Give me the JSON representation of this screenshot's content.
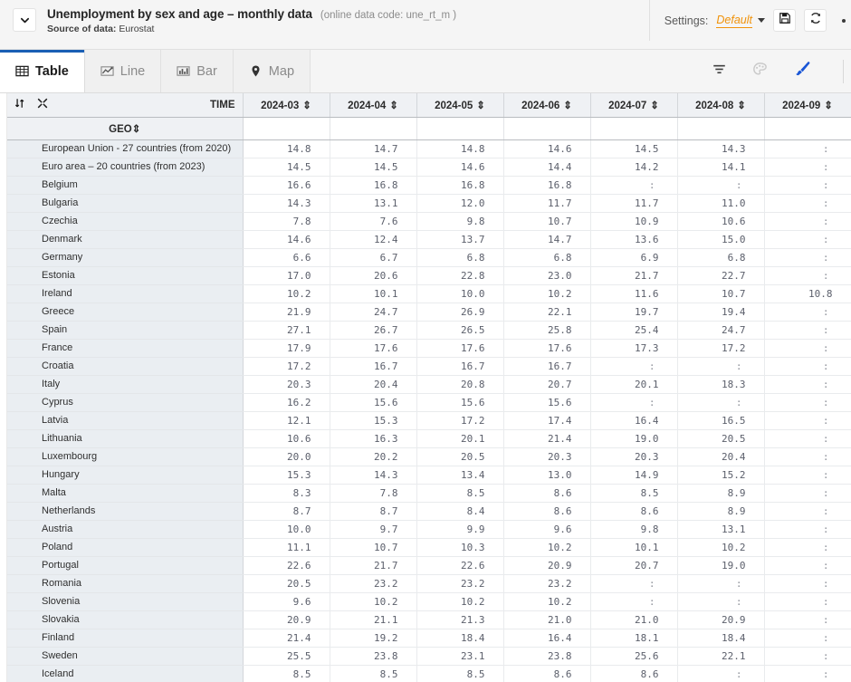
{
  "header": {
    "collapse_icon": "chevron-down-icon",
    "title": "Unemployment by sex and age – monthly data",
    "code": "(online data code: une_rt_m )",
    "source_label": "Source of data:",
    "source_value": "Eurostat",
    "settings_label": "Settings:",
    "settings_value": "Default",
    "save_icon": "floppy-disk-icon",
    "refresh_icon": "refresh-icon",
    "overflow_icon": "kebab-menu-icon",
    "accent_color": "#f0920a"
  },
  "tabs": [
    {
      "label": "Table",
      "icon": "table-grid-icon",
      "active": true
    },
    {
      "label": "Line",
      "icon": "line-chart-icon",
      "active": false
    },
    {
      "label": "Bar",
      "icon": "bar-chart-icon",
      "active": false
    },
    {
      "label": "Map",
      "icon": "map-pin-icon",
      "active": false
    }
  ],
  "toolbar": {
    "filter_icon": "filter-funnel-icon",
    "palette_icon": "color-palette-icon",
    "brush_icon": "paint-brush-icon",
    "active_tool_color": "#1a56d6"
  },
  "table": {
    "time_label": "TIME",
    "geo_label": "GEO",
    "sort_icon": "sort-arrows-icon",
    "collapse_columns_icon": "collapse-arrows-icon",
    "sort_toggle_icon": "sort-updown-icon",
    "no_data_symbol": ":",
    "columns": [
      "2024-03",
      "2024-04",
      "2024-05",
      "2024-06",
      "2024-07",
      "2024-08",
      "2024-09"
    ],
    "rows": [
      {
        "geo": "European Union - 27 countries (from 2020)",
        "values": [
          "14.8",
          "14.7",
          "14.8",
          "14.6",
          "14.5",
          "14.3",
          ":"
        ]
      },
      {
        "geo": "Euro area – 20 countries (from 2023)",
        "values": [
          "14.5",
          "14.5",
          "14.6",
          "14.4",
          "14.2",
          "14.1",
          ":"
        ]
      },
      {
        "geo": "Belgium",
        "values": [
          "16.6",
          "16.8",
          "16.8",
          "16.8",
          ":",
          ":",
          ":"
        ]
      },
      {
        "geo": "Bulgaria",
        "values": [
          "14.3",
          "13.1",
          "12.0",
          "11.7",
          "11.7",
          "11.0",
          ":"
        ]
      },
      {
        "geo": "Czechia",
        "values": [
          "7.8",
          "7.6",
          "9.8",
          "10.7",
          "10.9",
          "10.6",
          ":"
        ]
      },
      {
        "geo": "Denmark",
        "values": [
          "14.6",
          "12.4",
          "13.7",
          "14.7",
          "13.6",
          "15.0",
          ":"
        ]
      },
      {
        "geo": "Germany",
        "values": [
          "6.6",
          "6.7",
          "6.8",
          "6.8",
          "6.9",
          "6.8",
          ":"
        ]
      },
      {
        "geo": "Estonia",
        "values": [
          "17.0",
          "20.6",
          "22.8",
          "23.0",
          "21.7",
          "22.7",
          ":"
        ]
      },
      {
        "geo": "Ireland",
        "values": [
          "10.2",
          "10.1",
          "10.0",
          "10.2",
          "11.6",
          "10.7",
          "10.8"
        ]
      },
      {
        "geo": "Greece",
        "values": [
          "21.9",
          "24.7",
          "26.9",
          "22.1",
          "19.7",
          "19.4",
          ":"
        ]
      },
      {
        "geo": "Spain",
        "values": [
          "27.1",
          "26.7",
          "26.5",
          "25.8",
          "25.4",
          "24.7",
          ":"
        ]
      },
      {
        "geo": "France",
        "values": [
          "17.9",
          "17.6",
          "17.6",
          "17.6",
          "17.3",
          "17.2",
          ":"
        ]
      },
      {
        "geo": "Croatia",
        "values": [
          "17.2",
          "16.7",
          "16.7",
          "16.7",
          ":",
          ":",
          ":"
        ]
      },
      {
        "geo": "Italy",
        "values": [
          "20.3",
          "20.4",
          "20.8",
          "20.7",
          "20.1",
          "18.3",
          ":"
        ]
      },
      {
        "geo": "Cyprus",
        "values": [
          "16.2",
          "15.6",
          "15.6",
          "15.6",
          ":",
          ":",
          ":"
        ]
      },
      {
        "geo": "Latvia",
        "values": [
          "12.1",
          "15.3",
          "17.2",
          "17.4",
          "16.4",
          "16.5",
          ":"
        ]
      },
      {
        "geo": "Lithuania",
        "values": [
          "10.6",
          "16.3",
          "20.1",
          "21.4",
          "19.0",
          "20.5",
          ":"
        ]
      },
      {
        "geo": "Luxembourg",
        "values": [
          "20.0",
          "20.2",
          "20.5",
          "20.3",
          "20.3",
          "20.4",
          ":"
        ]
      },
      {
        "geo": "Hungary",
        "values": [
          "15.3",
          "14.3",
          "13.4",
          "13.0",
          "14.9",
          "15.2",
          ":"
        ]
      },
      {
        "geo": "Malta",
        "values": [
          "8.3",
          "7.8",
          "8.5",
          "8.6",
          "8.5",
          "8.9",
          ":"
        ]
      },
      {
        "geo": "Netherlands",
        "values": [
          "8.7",
          "8.7",
          "8.4",
          "8.6",
          "8.6",
          "8.9",
          ":"
        ]
      },
      {
        "geo": "Austria",
        "values": [
          "10.0",
          "9.7",
          "9.9",
          "9.6",
          "9.8",
          "13.1",
          ":"
        ]
      },
      {
        "geo": "Poland",
        "values": [
          "11.1",
          "10.7",
          "10.3",
          "10.2",
          "10.1",
          "10.2",
          ":"
        ]
      },
      {
        "geo": "Portugal",
        "values": [
          "22.6",
          "21.7",
          "22.6",
          "20.9",
          "20.7",
          "19.0",
          ":"
        ]
      },
      {
        "geo": "Romania",
        "values": [
          "20.5",
          "23.2",
          "23.2",
          "23.2",
          ":",
          ":",
          ":"
        ]
      },
      {
        "geo": "Slovenia",
        "values": [
          "9.6",
          "10.2",
          "10.2",
          "10.2",
          ":",
          ":",
          ":"
        ]
      },
      {
        "geo": "Slovakia",
        "values": [
          "20.9",
          "21.1",
          "21.3",
          "21.0",
          "21.0",
          "20.9",
          ":"
        ]
      },
      {
        "geo": "Finland",
        "values": [
          "21.4",
          "19.2",
          "18.4",
          "16.4",
          "18.1",
          "18.4",
          ":"
        ]
      },
      {
        "geo": "Sweden",
        "values": [
          "25.5",
          "23.8",
          "23.1",
          "23.8",
          "25.6",
          "22.1",
          ":"
        ]
      },
      {
        "geo": "Iceland",
        "values": [
          "8.5",
          "8.5",
          "8.5",
          "8.6",
          "8.6",
          ":",
          ":"
        ]
      }
    ]
  }
}
